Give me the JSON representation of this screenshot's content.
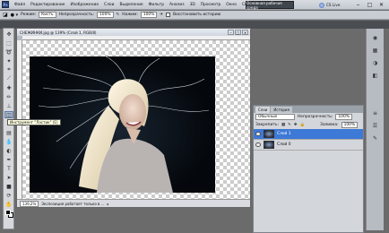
{
  "menubar": {
    "logo": "Ps",
    "items": [
      "Файл",
      "Редактирование",
      "Изображение",
      "Слои",
      "Выделение",
      "Фильтр",
      "Анализ",
      "3D",
      "Просмотр",
      "Окно",
      "Справка"
    ],
    "workspace_button": "Основная рабочая среда",
    "cs_live": "CS Live"
  },
  "options": {
    "mode_label": "Режим:",
    "mode_value": "Кисть",
    "opacity_label": "Непрозрачность:",
    "opacity_value": "100%",
    "pressure_label": "Нажим:",
    "pressure_value": "100%",
    "history_label": "Восстановить историю"
  },
  "document": {
    "title": "СНЕЖИНКИ.jpg @ 139% (Слой 1, RGB/8)",
    "zoom": "139,2%",
    "status": "Экспозиция работает только в ..."
  },
  "tooltip": "Инструмент \"Ластик\" (E)",
  "layers_panel": {
    "tabs": [
      "Слои",
      "История"
    ],
    "blend_mode": "Обычные",
    "opacity_label": "Непрозрачность:",
    "opacity_value": "100%",
    "lock_label": "Закрепить:",
    "fill_label": "Заливка:",
    "fill_value": "100%",
    "layers": [
      {
        "name": "Слой 1",
        "selected": true
      },
      {
        "name": "Слой 0",
        "selected": false
      }
    ]
  },
  "colors": {
    "accent": "#3d79d6",
    "chrome": "#c8ccd3"
  }
}
